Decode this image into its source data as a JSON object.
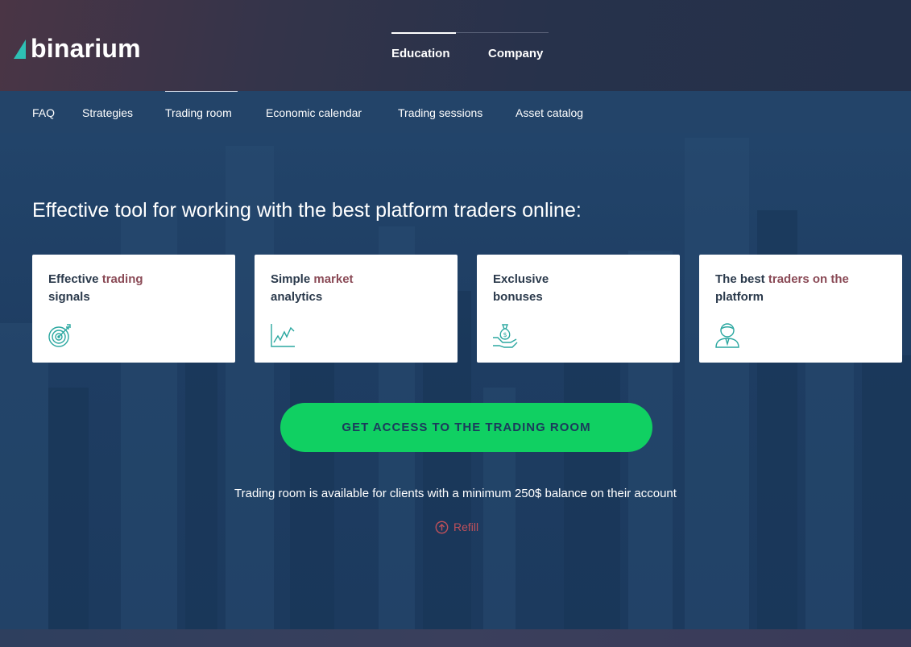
{
  "brand": {
    "name": "binarium",
    "accent_color": "#2ec0b4"
  },
  "top_nav": {
    "items": [
      {
        "label": "Education",
        "active": true
      },
      {
        "label": "Company",
        "active": false
      }
    ]
  },
  "sub_nav": {
    "items": [
      {
        "label": "FAQ"
      },
      {
        "label": "Strategies"
      },
      {
        "label": "Trading room",
        "active": true
      },
      {
        "label": "Economic calendar"
      },
      {
        "label": "Trading sessions"
      },
      {
        "label": "Asset catalog"
      }
    ]
  },
  "hero": {
    "headline": "Effective tool for working with the best platform traders online:",
    "cards": [
      {
        "title_parts": [
          "Effective ",
          "trading",
          "\nsignals"
        ],
        "icon": "target-icon"
      },
      {
        "title_parts": [
          "Simple ",
          "market",
          "\nanalytics"
        ],
        "icon": "chart-icon"
      },
      {
        "title_parts": [
          "Exclusive\nbonuses"
        ],
        "icon": "money-bag-icon"
      },
      {
        "title_parts": [
          "The best ",
          "traders on the",
          "\nplatform"
        ],
        "icon": "trader-icon"
      }
    ],
    "cta_label": "GET ACCESS TO THE TRADING ROOM",
    "cta_color": "#10d062",
    "note": "Trading room is available for clients with a minimum 250$ balance on their account",
    "refill_label": "Refill",
    "refill_icon": "arrow-up-circle-icon",
    "refill_color": "#c0505a"
  }
}
